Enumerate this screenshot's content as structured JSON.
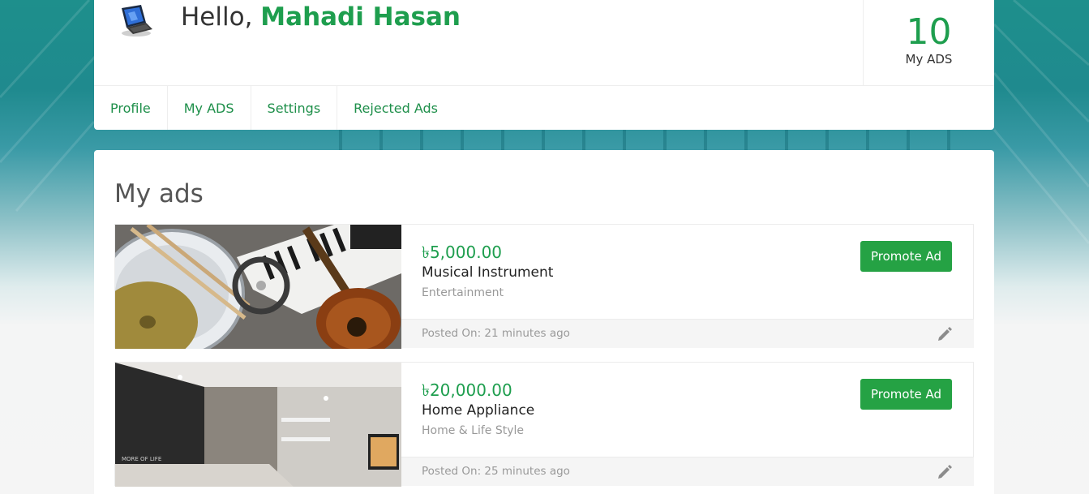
{
  "header": {
    "greeting_prefix": "Hello,",
    "user_name": "Mahadi Hasan",
    "avatar_icon": "laptop-avatar-icon",
    "stats": {
      "count": "10",
      "label": "My ADS"
    }
  },
  "tabs": [
    {
      "label": "Profile"
    },
    {
      "label": "My ADS"
    },
    {
      "label": "Settings"
    },
    {
      "label": "Rejected Ads"
    }
  ],
  "main": {
    "title": "My ads",
    "ads": [
      {
        "price": "৳5,000.00",
        "title": "Musical Instrument",
        "category": "Entertainment",
        "promote_label": "Promote Ad",
        "posted": "Posted On: 21 minutes ago",
        "image_icon": "musical-instruments-photo"
      },
      {
        "price": "৳20,000.00",
        "title": "Home Appliance",
        "category": "Home & Life Style",
        "promote_label": "Promote Ad",
        "posted": "Posted On: 25 minutes ago",
        "image_icon": "room-interior-photo"
      }
    ]
  },
  "colors": {
    "accent": "#1e9e4e",
    "button": "#25a244",
    "muted": "#999999"
  }
}
